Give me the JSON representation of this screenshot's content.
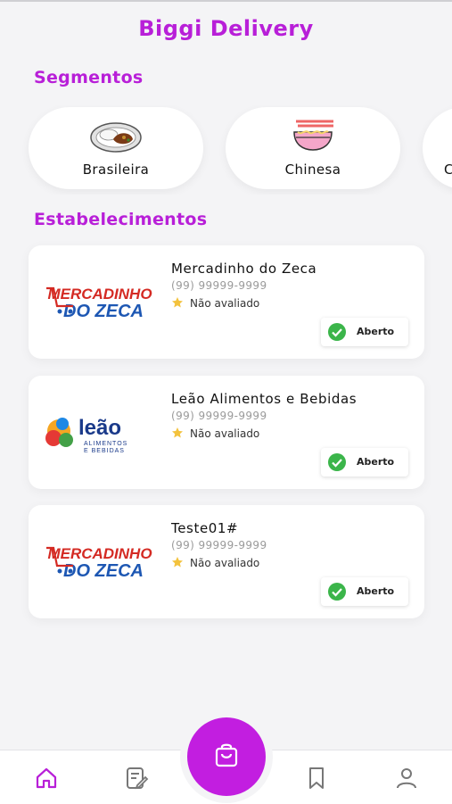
{
  "header": {
    "title": "Biggi Delivery"
  },
  "segments": {
    "title": "Segmentos",
    "items": [
      {
        "label": "Brasileira",
        "icon": "rice-plate-icon"
      },
      {
        "label": "Chinesa",
        "icon": "noodle-bowl-icon"
      },
      {
        "label": "C",
        "icon": ""
      }
    ]
  },
  "establishments": {
    "title": "Estabelecimentos",
    "items": [
      {
        "name": "Mercadinho do Zeca",
        "phone": "(99) 99999-9999",
        "rating": "Não avaliado",
        "status": "Aberto",
        "logo": "mercadinho-logo"
      },
      {
        "name": "Leão Alimentos e Bebidas",
        "phone": "(99) 99999-9999",
        "rating": "Não avaliado",
        "status": "Aberto",
        "logo": "leao-logo"
      },
      {
        "name": "Teste01#",
        "phone": "(99) 99999-9999",
        "rating": "Não avaliado",
        "status": "Aberto",
        "logo": "mercadinho-logo"
      }
    ]
  },
  "logos": {
    "mercadinho_top": "MERCADINHO",
    "mercadinho_bottom": "DO ZECA",
    "leao_word": "leão",
    "leao_sub1": "ALIMENTOS",
    "leao_sub2": "E BEBIDAS"
  },
  "bottom_nav": {
    "items": [
      {
        "icon": "home-icon",
        "active": true
      },
      {
        "icon": "orders-icon",
        "active": false
      },
      {
        "icon": "bookmark-icon",
        "active": false
      },
      {
        "icon": "user-icon",
        "active": false
      }
    ],
    "fab_icon": "shopping-bag-icon"
  },
  "colors": {
    "accent": "#b81fd8",
    "fab": "#c21ee0",
    "open_green": "#3bb54a"
  }
}
